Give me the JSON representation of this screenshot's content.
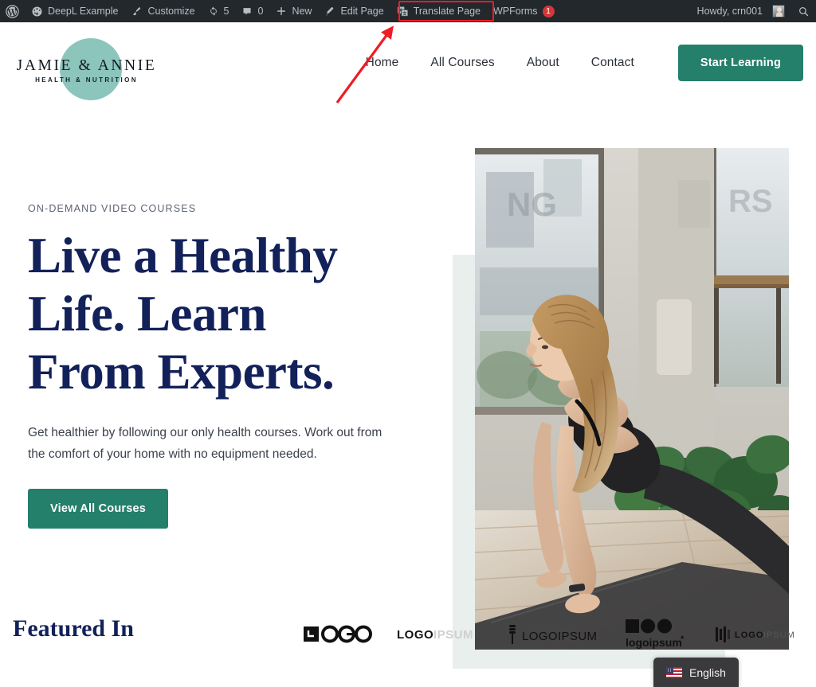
{
  "adminbar": {
    "wp_logo_icon": "wordpress-icon",
    "items": [
      {
        "id": "site-name",
        "label": "DeepL Example",
        "icon": "dashboard-icon"
      },
      {
        "id": "customize",
        "label": "Customize",
        "icon": "paintbrush-icon"
      },
      {
        "id": "updates",
        "label": "5",
        "icon": "updates-icon"
      },
      {
        "id": "comments",
        "label": "0",
        "icon": "comment-bubble-icon"
      },
      {
        "id": "new-content",
        "label": "New",
        "icon": "plus-icon"
      },
      {
        "id": "edit-page",
        "label": "Edit Page",
        "icon": "pencil-icon"
      },
      {
        "id": "translate-page",
        "label": "Translate Page",
        "icon": "translate-icon"
      },
      {
        "id": "wpforms",
        "label": "WPForms",
        "icon": "",
        "badge": "1"
      }
    ],
    "howdy": "Howdy, crn001",
    "search_icon": "search-icon",
    "avatar": "user-avatar",
    "highlight_color": "#ee1c25"
  },
  "header": {
    "logo": {
      "name": "JAMIE & ANNIE",
      "tagline": "HEALTH & NUTRITION",
      "circle_color": "#8cc5bb"
    },
    "nav": [
      {
        "label": "Home"
      },
      {
        "label": "All Courses"
      },
      {
        "label": "About"
      },
      {
        "label": "Contact"
      }
    ],
    "cta_label": "Start Learning",
    "cta_color": "#247f6b"
  },
  "hero": {
    "eyebrow": "ON-DEMAND VIDEO COURSES",
    "title_line1": "Live a Healthy",
    "title_line2": "Life. Learn",
    "title_line3": "From Experts.",
    "title_color": "#12215a",
    "paragraph": "Get healthier by following our only health courses. Work out from the comfort of your home with no equipment needed.",
    "button_label": "View All Courses",
    "button_color": "#247f6b",
    "image_alt": "Woman in black sportswear doing a yoga plank pose on a mat in a bright studio with potted plants",
    "backdrop_color": "#e9efec"
  },
  "featured": {
    "title": "Featured In",
    "logos": [
      {
        "id": "logo-1",
        "label": "LOGO"
      },
      {
        "id": "logo-2",
        "label": "LOGOIPSUM"
      },
      {
        "id": "logo-3",
        "label": "LOGOIPSUM"
      },
      {
        "id": "logo-4",
        "label": "logoipsum"
      },
      {
        "id": "logo-5",
        "label": "LOGOIPSUM"
      }
    ]
  },
  "language_switcher": {
    "current": "English",
    "flag": "us-flag-icon"
  }
}
